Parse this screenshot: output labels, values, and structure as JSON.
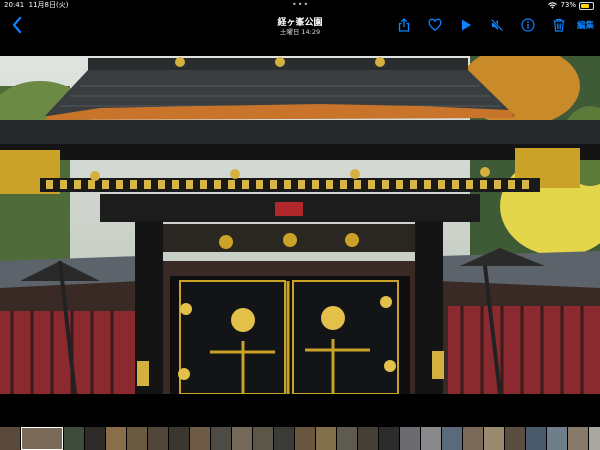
{
  "status_bar": {
    "time": "20:41",
    "date": "11月8日(火)",
    "more": "•••",
    "battery": "73%",
    "battery_level": 0.73
  },
  "nav": {
    "title": "経ヶ峯公園",
    "subtitle": "土曜日 14:29",
    "edit_label": "編集"
  },
  "icons": {
    "back": "chevron-left-icon",
    "share": "share-icon",
    "favorite": "heart-icon",
    "play": "play-icon",
    "mute": "speaker-muted-icon",
    "info": "info-icon",
    "delete": "trash-icon",
    "wifi": "wifi-icon",
    "battery": "battery-icon"
  },
  "colors": {
    "accent": "#0a84ff",
    "battery": "#ffd60a",
    "background": "#000000"
  },
  "filmstrip": {
    "thumbnails": [
      "#5a4a3c",
      "#7c6a58",
      "#3e4a3a",
      "#2e2a28",
      "#8a6e4a",
      "#6a5a40",
      "#50463c",
      "#3a3630",
      "#6e5c46",
      "#4e4a44",
      "#746a5a",
      "#5c5648",
      "#3a3a36",
      "#68563e",
      "#82704c",
      "#5e5a50",
      "#444038",
      "#2c2c2c",
      "#6c6c70",
      "#8a8a8c",
      "#5a6a7a",
      "#7a6a5a",
      "#9a8a70",
      "#5a4e40",
      "#4a5a6a",
      "#6e7e8a",
      "#8a7a6a",
      "#a8a8a0",
      "#6a6a60",
      "#507080"
    ],
    "selected_index": 1
  }
}
